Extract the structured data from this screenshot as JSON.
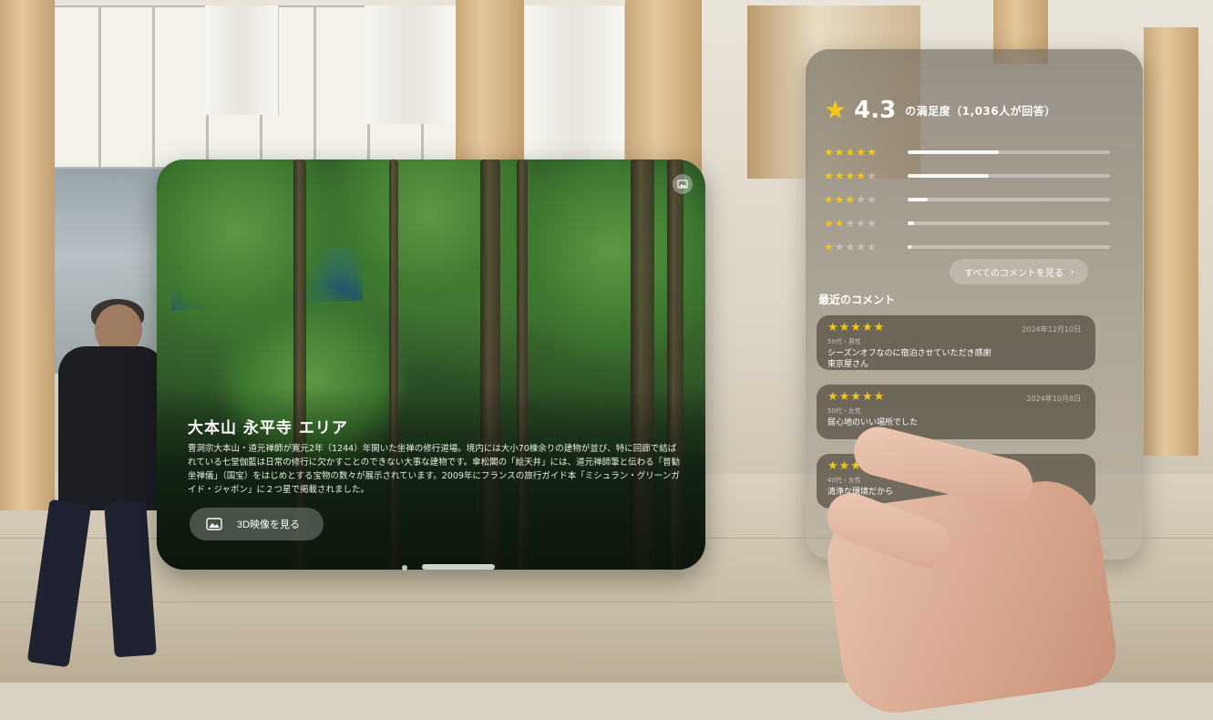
{
  "media": {
    "title": "大本山 永平寺 エリア",
    "description": "曹洞宗大本山・道元禅師が寛元2年（1244）年開いた坐禅の修行道場。境内には大小70棟余りの建物が並び、特に回廊で結ばれている七堂伽藍は日常の修行に欠かすことのできない大事な建物です。傘松閣の「絵天井」には、道元禅師筆と伝わる「普勧坐禅儀」（国宝）をはじめとする宝物の数々が展示されています。2009年にフランスの旅行ガイド本「ミシュラン・グリーンガイド・ジャポン」に２つ星で掲載されました。",
    "view_3d_label": "3D映像を見る",
    "photo_icon": "photo-icon"
  },
  "reviews": {
    "score": "4.3",
    "score_suffix": "の満足度（1,036人が回答）",
    "distribution": [
      {
        "stars": 5,
        "fraction": 0.45
      },
      {
        "stars": 4,
        "fraction": 0.4
      },
      {
        "stars": 3,
        "fraction": 0.1
      },
      {
        "stars": 2,
        "fraction": 0.03
      },
      {
        "stars": 1,
        "fraction": 0.02
      }
    ],
    "all_comments_label": "すべてのコメントを見る",
    "recent_heading": "最近のコメント",
    "comments": [
      {
        "stars": 5,
        "date": "2024年12月10日",
        "meta": "50代・男性",
        "body": "シーズンオフなのに宿泊させていただき感謝\n東京屋さん"
      },
      {
        "stars": 5,
        "date": "2024年10月8日",
        "meta": "50代・女性",
        "body": "居心地のいい場所でした"
      },
      {
        "stars": 5,
        "date": "",
        "meta": "40代・女性",
        "body": "清浄な環境だから"
      }
    ],
    "star_color": "#f5c518"
  }
}
